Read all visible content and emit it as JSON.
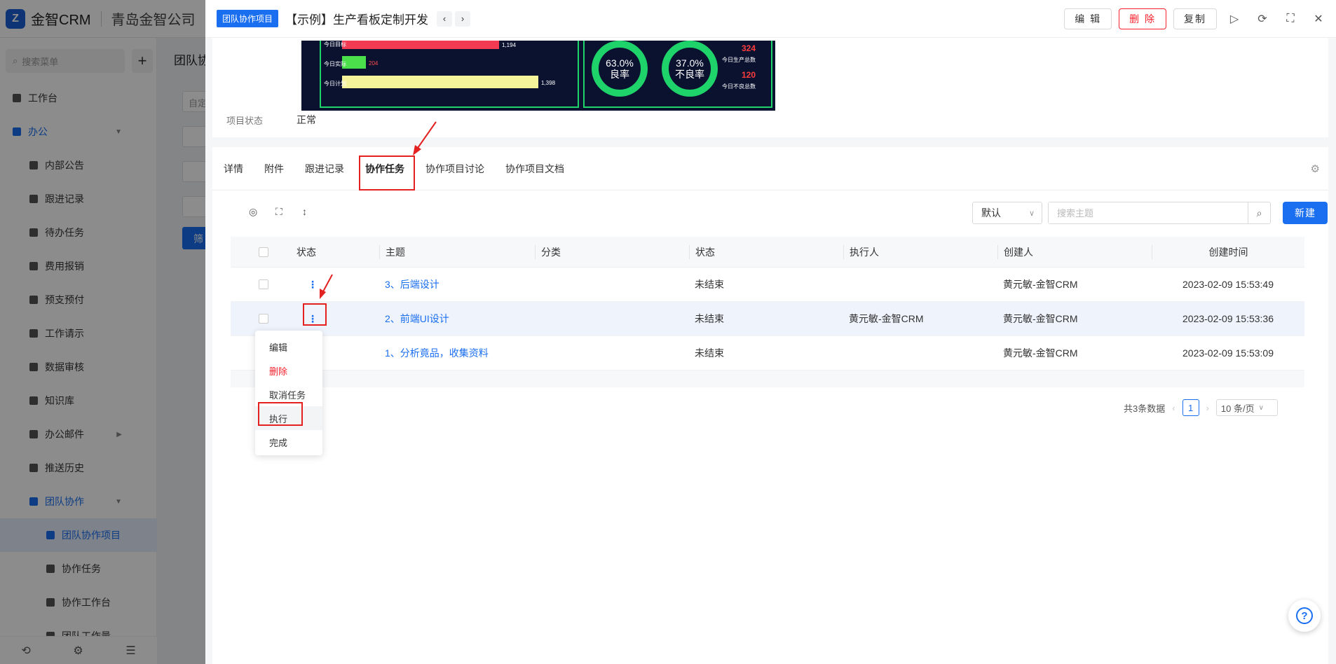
{
  "app": {
    "logo_text": "金智CRM",
    "company": "青岛金智公司"
  },
  "sidebar": {
    "search_placeholder": "搜索菜单",
    "items": [
      {
        "label": "工作台"
      },
      {
        "label": "办公"
      },
      {
        "label": "内部公告"
      },
      {
        "label": "跟进记录"
      },
      {
        "label": "待办任务"
      },
      {
        "label": "费用报销"
      },
      {
        "label": "预支预付"
      },
      {
        "label": "工作请示"
      },
      {
        "label": "数据审核"
      },
      {
        "label": "知识库"
      },
      {
        "label": "办公邮件"
      },
      {
        "label": "推送历史"
      },
      {
        "label": "团队协作"
      },
      {
        "label": "团队协作项目"
      },
      {
        "label": "协作任务"
      },
      {
        "label": "协作工作台"
      },
      {
        "label": "团队工作量"
      }
    ]
  },
  "bg": {
    "page_title": "团队协",
    "filter_btn": "筛",
    "input_text": "自定"
  },
  "drawer": {
    "tag": "团队协作项目",
    "title": "【示例】生产看板定制开发",
    "edit_label": "编 辑",
    "delete_label": "删 除",
    "copy_label": "复制",
    "status_label": "项目状态",
    "status_value": "正常"
  },
  "dashboard": {
    "rows": [
      {
        "label": "今日目标",
        "value": "1,194"
      },
      {
        "label": "今日实际",
        "value": "204"
      },
      {
        "label": "今日计划",
        "value": "1,398"
      }
    ],
    "good_rate": "63.0%",
    "good_label": "良率",
    "bad_rate": "37.0%",
    "bad_label": "不良率",
    "total_num": "324",
    "total_label": "今日生产总数",
    "bad_num": "120",
    "bad_num_label": "今日不良总数"
  },
  "tabs": [
    {
      "label": "详情"
    },
    {
      "label": "附件"
    },
    {
      "label": "跟进记录"
    },
    {
      "label": "协作任务"
    },
    {
      "label": "协作项目讨论"
    },
    {
      "label": "协作项目文档"
    }
  ],
  "toolbar": {
    "select_value": "默认",
    "search_placeholder": "搜索主题",
    "new_label": "新建"
  },
  "table": {
    "headers": {
      "status": "状态",
      "subject": "主题",
      "category": "分类",
      "state": "状态",
      "executor": "执行人",
      "creator": "创建人",
      "created": "创建时间"
    },
    "rows": [
      {
        "subject": "3、后端设计",
        "category": "",
        "state": "未结束",
        "executor": "",
        "creator": "黄元敏-金智CRM",
        "created": "2023-02-09 15:53:49"
      },
      {
        "subject": "2、前端UI设计",
        "category": "",
        "state": "未结束",
        "executor": "黄元敏-金智CRM",
        "creator": "黄元敏-金智CRM",
        "created": "2023-02-09 15:53:36"
      },
      {
        "subject": "1、分析竟品，收集资料",
        "category": "",
        "state": "未结束",
        "executor": "",
        "creator": "黄元敏-金智CRM",
        "created": "2023-02-09 15:53:09"
      }
    ]
  },
  "pager": {
    "total": "共3条数据",
    "page": "1",
    "size": "10 条/页"
  },
  "menu": {
    "items": [
      {
        "label": "编辑"
      },
      {
        "label": "删除"
      },
      {
        "label": "取消任务"
      },
      {
        "label": "执行"
      },
      {
        "label": "完成"
      }
    ]
  },
  "colors": {
    "primary": "#1a6ef0",
    "danger": "#f5222d",
    "annotation": "#e32121"
  }
}
